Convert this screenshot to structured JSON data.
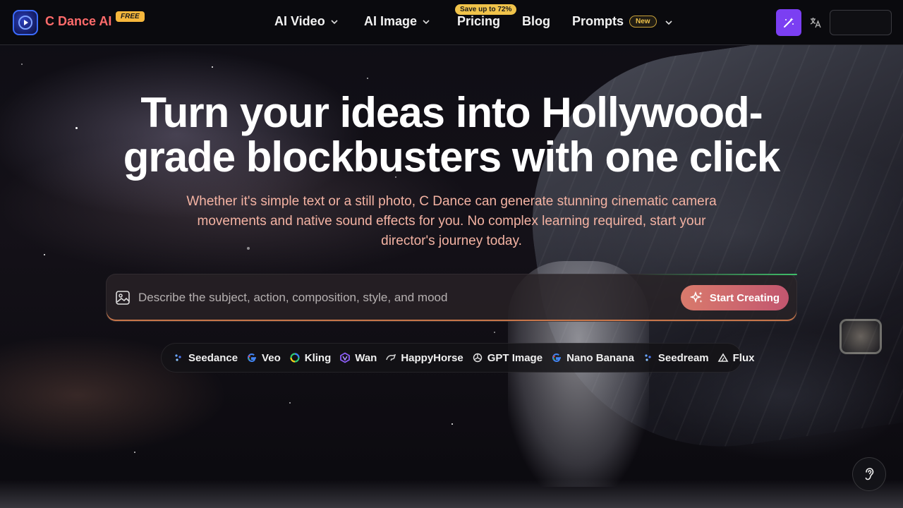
{
  "header": {
    "brand": "C Dance AI",
    "brand_badge": "FREE",
    "nav": [
      {
        "label": "AI Video",
        "has_dropdown": true
      },
      {
        "label": "AI Image",
        "has_dropdown": true
      },
      {
        "label": "Pricing",
        "badge": "Save up to 72%"
      },
      {
        "label": "Blog"
      },
      {
        "label": "Prompts",
        "badge": "New",
        "has_dropdown": true
      }
    ],
    "icons": {
      "logo": "play-logo-icon",
      "magic": "magic-wand-icon",
      "language": "translate-icon"
    }
  },
  "hero": {
    "title_line1": "Turn your ideas into Hollywood-",
    "title_line2": "grade blockbusters with one click",
    "subtitle": "Whether it's simple text or a still photo, C Dance can generate stunning cinematic camera movements and native sound effects for you. No complex learning required, start your director's journey today."
  },
  "prompt": {
    "placeholder": "Describe the subject, action, composition, style, and mood",
    "value": "",
    "button_label": "Start Creating"
  },
  "models": [
    {
      "label": "Seedance",
      "icon": "seedance-icon"
    },
    {
      "label": "Veo",
      "icon": "google-icon"
    },
    {
      "label": "Kling",
      "icon": "kling-icon"
    },
    {
      "label": "Wan",
      "icon": "wan-icon"
    },
    {
      "label": "HappyHorse",
      "icon": "happyhorse-icon"
    },
    {
      "label": "GPT Image",
      "icon": "openai-icon"
    },
    {
      "label": "Nano Banana",
      "icon": "google-icon"
    },
    {
      "label": "Seedream",
      "icon": "seedream-icon"
    },
    {
      "label": "Flux",
      "icon": "flux-icon"
    }
  ],
  "colors": {
    "accent_purple": "#7b3ff2",
    "brand_red": "#ff6b6b",
    "subtitle_salmon": "#f4b3a3",
    "button_gradient_start": "#d97a6c",
    "button_gradient_end": "#c2566f",
    "badge_yellow": "#f0c34a"
  }
}
